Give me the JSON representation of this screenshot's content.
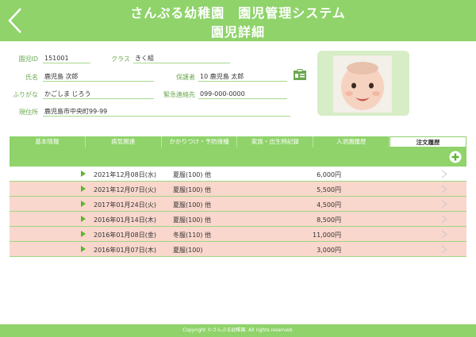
{
  "header": {
    "title_line1": "さんぷる幼稚園　園児管理システム",
    "title_line2": "園児詳細"
  },
  "child": {
    "id_label": "園児ID",
    "id_value": "151001",
    "class_label": "クラス",
    "class_value": "きく組",
    "name_label": "氏名",
    "name_value": "鹿児島 次郎",
    "guardian_label": "保護者",
    "guardian_value": "10 鹿児島 太郎",
    "kana_label": "ふりがな",
    "kana_value": "かごしま じろう",
    "emergency_label": "緊急連絡先",
    "emergency_value": "099-000-0000",
    "address_label": "現住所",
    "address_value": "鹿児島市中央町99-99"
  },
  "tabs": [
    {
      "label": "基本情報",
      "active": false
    },
    {
      "label": "病気関連",
      "active": false
    },
    {
      "label": "かかりつけ・予防接種",
      "active": false
    },
    {
      "label": "家族・出生時記録",
      "active": false
    },
    {
      "label": "入退園履歴",
      "active": false
    },
    {
      "label": "注文履歴",
      "active": true
    }
  ],
  "orders": [
    {
      "date": "2021年12月08日(水)",
      "item": "夏服(100) 他",
      "price": "6,000円"
    },
    {
      "date": "2021年12月07日(火)",
      "item": "夏服(100) 他",
      "price": "5,500円"
    },
    {
      "date": "2017年01月24日(火)",
      "item": "夏服(100) 他",
      "price": "4,500円"
    },
    {
      "date": "2016年01月14日(木)",
      "item": "夏服(100) 他",
      "price": "8,500円"
    },
    {
      "date": "2016年01月08日(金)",
      "item": "冬服(110) 他",
      "price": "11,000円"
    },
    {
      "date": "2016年01月07日(木)",
      "item": "夏服(100)",
      "price": "3,000円"
    }
  ],
  "footer": {
    "copyright": "Copyright ©さんぷる幼稚園. All rights reserved."
  },
  "colors": {
    "accent_green": "#8fd36a",
    "row_pink": "#f9d7cc",
    "label_green": "#6aa84f"
  },
  "icons": [
    "back-chevron-icon",
    "id-card-icon",
    "plus-circle-icon",
    "play-triangle-icon",
    "chevron-right-icon"
  ]
}
